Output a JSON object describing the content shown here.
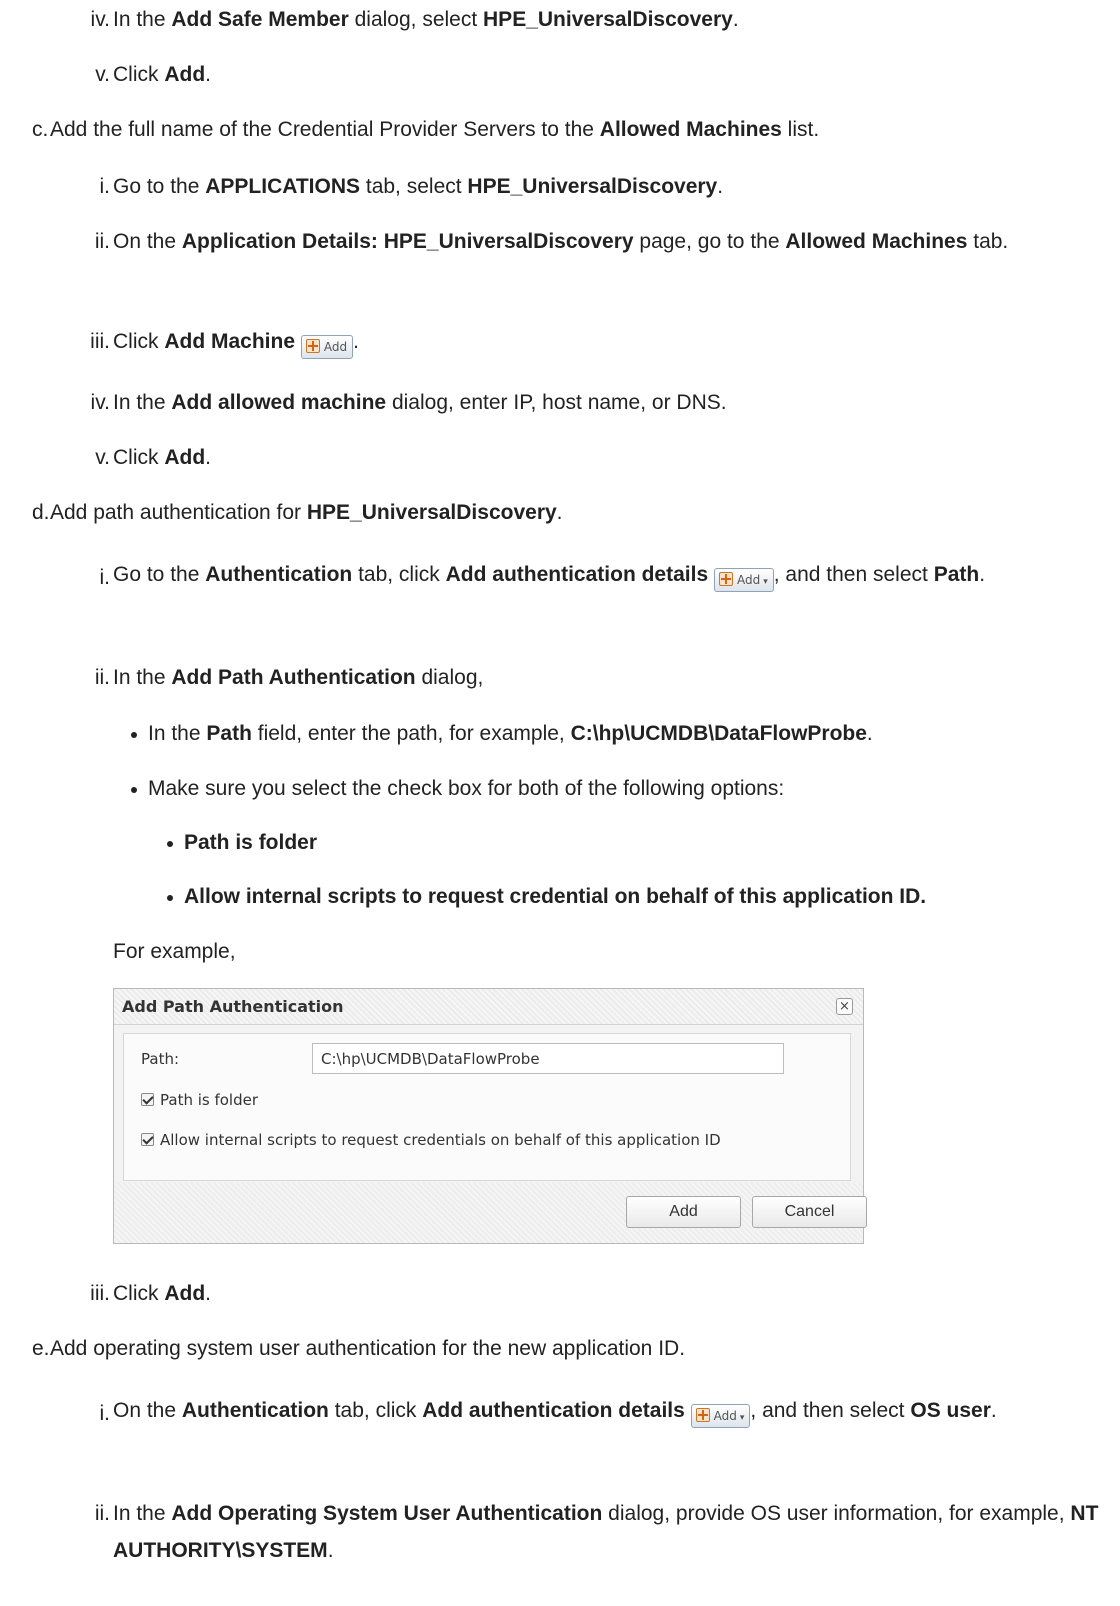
{
  "steps": [
    {
      "marker": "iv.",
      "parts": [
        "In the ",
        "Add Safe Member",
        " dialog, select ",
        "HPE_UniversalDiscovery",
        "."
      ]
    },
    {
      "marker": "v.",
      "parts": [
        "Click ",
        "Add",
        "."
      ]
    },
    {
      "marker": "c.",
      "parts": [
        "Add the full name of the Credential Provider Servers to the ",
        "Allowed Machines",
        " list."
      ]
    },
    {
      "marker": "i.",
      "parts": [
        "Go to the ",
        "APPLICATIONS",
        " tab, select ",
        "HPE_UniversalDiscovery",
        "."
      ]
    },
    {
      "marker": "ii.",
      "parts": [
        "On the ",
        "Application Details: HPE_UniversalDiscovery",
        " page, go to the ",
        "Allowed Machines",
        " tab."
      ]
    },
    {
      "marker": "iii.",
      "parts": [
        "Click ",
        "Add Machine",
        "."
      ]
    },
    {
      "marker": "iv.",
      "parts": [
        "In the ",
        "Add allowed machine",
        " dialog, enter IP, host name, or DNS."
      ]
    },
    {
      "marker": "v.",
      "parts": [
        "Click ",
        "Add",
        "."
      ]
    },
    {
      "marker": "d.",
      "parts": [
        "Add path authentication for ",
        "HPE_UniversalDiscovery",
        "."
      ]
    },
    {
      "marker": "i.",
      "parts": [
        "Go to the ",
        "Authentication",
        " tab, click ",
        "Add authentication details",
        ", and then select ",
        "Path",
        "."
      ]
    },
    {
      "marker": "ii.",
      "parts": [
        "In the ",
        "Add Path Authentication",
        " dialog,"
      ]
    },
    {
      "marker": "",
      "parts": [
        "In the ",
        "Path",
        " field, enter the path, for example, ",
        "C:\\hp\\UCMDB\\DataFlowProbe",
        "."
      ]
    },
    {
      "marker": "",
      "parts": [
        "Make sure you select the check box for both of the following options:"
      ]
    },
    {
      "marker": "",
      "parts": [
        "Path is folder"
      ]
    },
    {
      "marker": "",
      "parts": [
        "Allow internal scripts to request credential on behalf of this application ID."
      ]
    },
    {
      "marker": "",
      "parts": [
        "For example,"
      ]
    },
    {
      "marker": "iii.",
      "parts": [
        "Click ",
        "Add",
        "."
      ]
    },
    {
      "marker": "e.",
      "parts": [
        "Add operating system user authentication for the new application ID."
      ]
    },
    {
      "marker": "i.",
      "parts": [
        "On the ",
        "Authentication",
        " tab, click ",
        "Add authentication details",
        ", and then select ",
        "OS user",
        "."
      ]
    },
    {
      "marker": "ii.",
      "parts": [
        "In the ",
        "Add Operating System User Authentication",
        " dialog, provide OS user information, for example, ",
        "NT AUTHORITY\\SYSTEM",
        "."
      ]
    }
  ],
  "buttons": {
    "add_machine_icon_label": "Add",
    "add_auth_icon_label": "Add"
  },
  "dialog": {
    "title": "Add Path Authentication",
    "close_glyph": "×",
    "path_label": "Path:",
    "path_value": "C:\\hp\\UCMDB\\DataFlowProbe",
    "checkbox_folder_label": "Path is folder",
    "checkbox_scripts_label": "Allow internal scripts to request credentials on behalf of this application ID",
    "add_button": "Add",
    "cancel_button": "Cancel"
  },
  "colors": {
    "text": "#222222",
    "plus_icon": "#d8611a"
  },
  "icons": [
    "add-plus-icon",
    "dropdown-caret-icon",
    "close-icon",
    "checkmark-icon"
  ]
}
